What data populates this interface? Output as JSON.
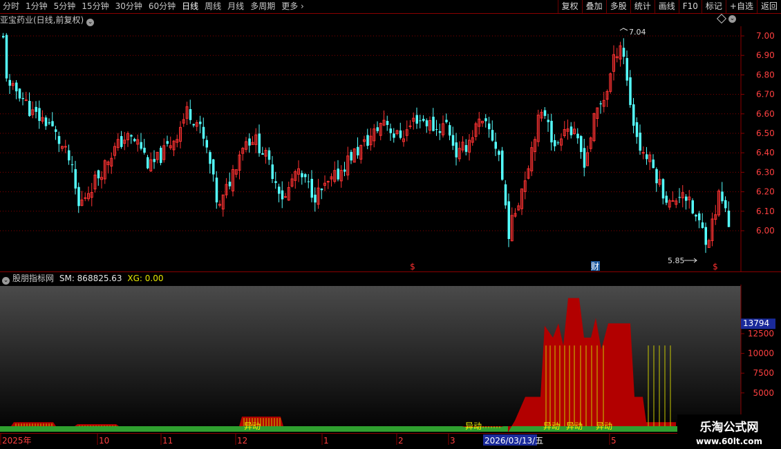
{
  "toolbar": {
    "periods": [
      "分时",
      "1分钟",
      "5分钟",
      "15分钟",
      "30分钟",
      "60分钟",
      "日线",
      "周线",
      "月线",
      "多周期",
      "更多"
    ],
    "active_period": "日线",
    "right_buttons": [
      "复权",
      "叠加",
      "多股",
      "统计",
      "画线",
      "F10",
      "标记",
      "+自选",
      "返回"
    ]
  },
  "main_chart": {
    "title": "亚宝药业(日线,前复权)",
    "high_label": "7.04",
    "low_label": "5.85",
    "price_axis": [
      "7.00",
      "6.90",
      "6.80",
      "6.70",
      "6.60",
      "6.50",
      "6.40",
      "6.30",
      "6.20",
      "6.10",
      "6.00"
    ],
    "markers": [
      "$",
      "财",
      "$"
    ]
  },
  "indicator": {
    "name": "股朋指标网",
    "sm_label": "SM: 868825.63",
    "xg_label": "XG: 0.00",
    "current_value": "13794",
    "axis": [
      "12500",
      "10000",
      "7500",
      "5000"
    ],
    "signal_label": "异动"
  },
  "date_axis": {
    "labels": [
      "2025年",
      "10",
      "11",
      "12",
      "1",
      "2",
      "3",
      "5"
    ],
    "cursor_date": "2026/03/13/五"
  },
  "watermark": {
    "title": "乐淘公式网",
    "url": "www.60lt.com"
  },
  "colors": {
    "up": "#ff3232",
    "down": "#54ffff",
    "grid": "#8b0000",
    "bar_red": "#b20000",
    "bar_green": "#2fa02f",
    "bar_yellow": "#c8c800"
  }
}
